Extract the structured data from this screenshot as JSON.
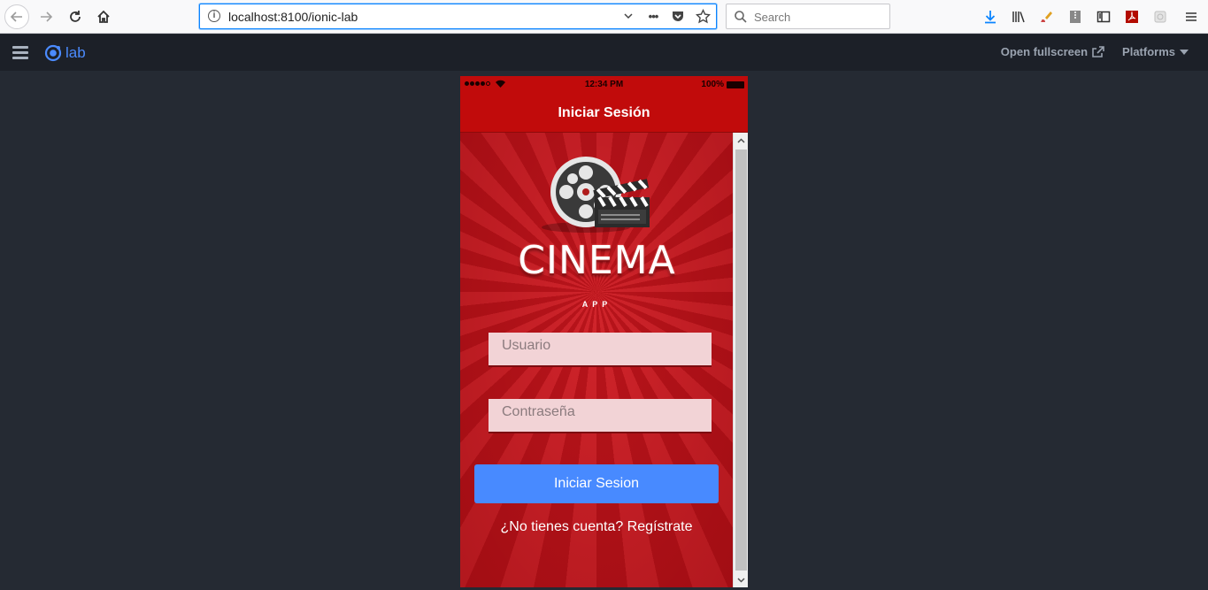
{
  "browser": {
    "url": "localhost:8100/ionic-lab",
    "search_placeholder": "Search",
    "url_info_glyph": "i",
    "url_more_glyph": "•••",
    "icons": {
      "back": "back-arrow-icon",
      "forward": "forward-arrow-icon",
      "reload": "reload-icon",
      "home": "home-icon",
      "downloads": "download-icon",
      "library": "library-icon",
      "menu": "hamburger-menu-icon"
    }
  },
  "lab": {
    "logo_text": "lab",
    "open_fullscreen": "Open fullscreen",
    "platforms": "Platforms",
    "accent": "#4b8bff"
  },
  "phone": {
    "status": {
      "time": "12:34 PM",
      "battery": "100%"
    },
    "title": "Iniciar Sesión",
    "logo": {
      "title": "CINEMA",
      "subtitle": "APP"
    },
    "username_placeholder": "Usuario",
    "password_placeholder": "Contraseña",
    "login_button": "Iniciar Sesion",
    "register_link": "¿No tienes cuenta? Regístrate",
    "colors": {
      "header": "#c10b0b",
      "button": "#488aff",
      "background": "#c8191c"
    }
  }
}
